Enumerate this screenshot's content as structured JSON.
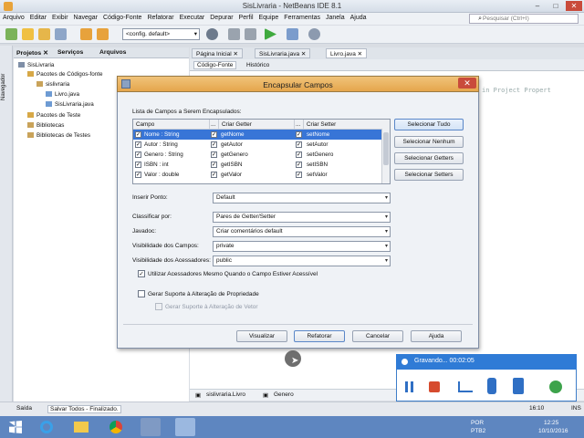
{
  "window": {
    "title": "SisLivraria - NetBeans IDE 8.1",
    "minimize": "–",
    "maximize": "□",
    "close": "✕"
  },
  "menu": [
    "Arquivo",
    "Editar",
    "Exibir",
    "Navegar",
    "Código-Fonte",
    "Refatorar",
    "Executar",
    "Depurar",
    "Perfil",
    "Equipe",
    "Ferramentas",
    "Janela",
    "Ajuda"
  ],
  "search": {
    "placeholder": "Pesquisar (Ctrl+I)"
  },
  "toolbar": {
    "config": "<config. default>"
  },
  "leftstrip": {
    "label": "Navegador"
  },
  "project_tabs": [
    "Projetos ✕",
    "Serviços",
    "Arquivos"
  ],
  "tree": [
    {
      "label": "SisLivraria",
      "level": 0
    },
    {
      "label": "Pacotes de Códigos-fonte",
      "level": 1
    },
    {
      "label": "sislivraria",
      "level": 2
    },
    {
      "label": "Livro.java",
      "level": 3
    },
    {
      "label": "SisLivraria.java",
      "level": 3
    },
    {
      "label": "Pacotes de Teste",
      "level": 1
    },
    {
      "label": "Bibliotecas",
      "level": 1
    },
    {
      "label": "Bibliotecas de Testes",
      "level": 1
    }
  ],
  "editor": {
    "tabs": [
      "Página Inicial ✕",
      "SisLivraria.java ✕",
      "Livro.java ✕"
    ],
    "source_tab": "Código-Fonte",
    "history_tab": "Histórico",
    "code_fragment": "in Project Propert"
  },
  "navbar": {
    "class": "sislivraria.Livro",
    "member": "Genero"
  },
  "status": {
    "output": "Saída",
    "message": "Salvar Todos - Finalizado.",
    "position": "16:10",
    "mode": "INS"
  },
  "dialog": {
    "title": "Encapsular Campos",
    "close": "✕",
    "list_label": "Lista de Campos a Serem Encapsulados:",
    "columns": {
      "field": "Campo",
      "dots": "...",
      "getter": "Criar Getter",
      "setter": "Criar Setter"
    },
    "rows": [
      {
        "field": "Nome : String",
        "getter": "getNome",
        "setter": "setNome",
        "selected": true
      },
      {
        "field": "Autor : String",
        "getter": "getAutor",
        "setter": "setAutor",
        "selected": false
      },
      {
        "field": "Genero : String",
        "getter": "getGenero",
        "setter": "setGenero",
        "selected": false
      },
      {
        "field": "ISBN : int",
        "getter": "getISBN",
        "setter": "setISBN",
        "selected": false
      },
      {
        "field": "Valor : double",
        "getter": "getValor",
        "setter": "setValor",
        "selected": false
      }
    ],
    "buttons_side": [
      "Selecionar Tudo",
      "Selecionar Nenhum",
      "Selecionar Getters",
      "Selecionar Setters"
    ],
    "insert_point": {
      "label": "Inserir Ponto:",
      "value": "Default"
    },
    "sort_by": {
      "label": "Classificar por:",
      "value": "Pares de Getter/Setter"
    },
    "javadoc": {
      "label": "Javadoc:",
      "value": "Criar comentários default"
    },
    "field_visibility": {
      "label": "Visibilidade dos Campos:",
      "value": "private"
    },
    "accessor_visibility": {
      "label": "Visibilidade dos Acessadores:",
      "value": "public"
    },
    "use_accessors": {
      "label": "Utilizar Acessadores Mesmo Quando o Campo Estiver Acessível",
      "checked": true
    },
    "property_change": {
      "label": "Gerar Suporte à Alteração de Propriedade",
      "checked": false
    },
    "vetoable_change": {
      "label": "Gerar Suporte à Alteração de Vetor",
      "checked": false
    },
    "buttons": {
      "preview": "Visualizar",
      "refactor": "Refatorar",
      "cancel": "Cancelar",
      "help": "Ajuda"
    }
  },
  "recorder": {
    "title": "Gravando... 00:02:05"
  },
  "tray": {
    "lang": "POR",
    "layout": "PTB2",
    "time": "12:25",
    "date": "10/10/2016"
  }
}
